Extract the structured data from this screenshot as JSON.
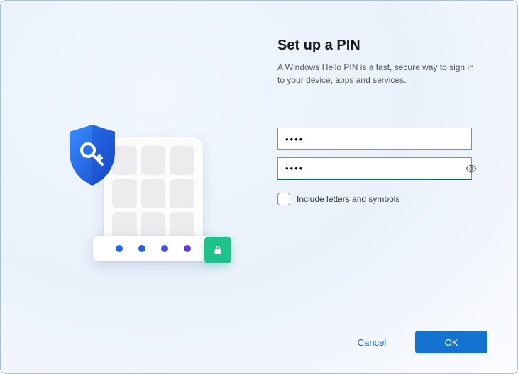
{
  "header": {
    "title": "Set up a PIN",
    "subtitle": "A Windows Hello PIN is a fast, secure way to sign in to your device, apps and services."
  },
  "form": {
    "pin_value": "••••",
    "confirm_value": "••••",
    "include_symbols_label": "Include letters and symbols",
    "include_symbols_checked": false
  },
  "footer": {
    "cancel_label": "Cancel",
    "ok_label": "OK"
  },
  "illustration": {
    "shield_icon": "shield-key-icon",
    "lock_icon": "unlock-icon"
  }
}
